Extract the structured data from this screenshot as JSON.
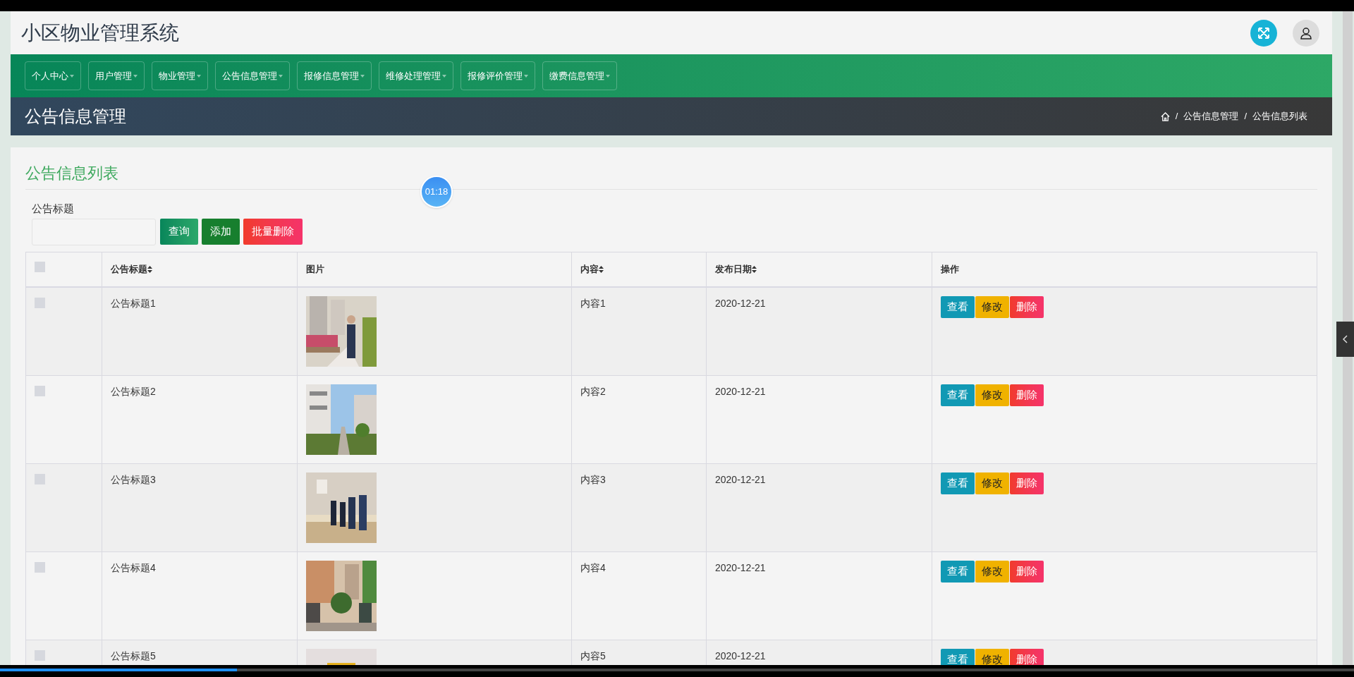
{
  "header": {
    "title": "小区物业管理系统"
  },
  "nav": [
    {
      "label": "个人中心"
    },
    {
      "label": "用户管理"
    },
    {
      "label": "物业管理"
    },
    {
      "label": "公告信息管理"
    },
    {
      "label": "报修信息管理"
    },
    {
      "label": "维修处理管理"
    },
    {
      "label": "报修评价管理"
    },
    {
      "label": "缴费信息管理"
    }
  ],
  "page_title": "公告信息管理",
  "breadcrumb": [
    {
      "separator": "/",
      "label": "公告信息管理"
    },
    {
      "separator": "/",
      "label": "公告信息列表"
    }
  ],
  "card": {
    "title": "公告信息列表",
    "search": {
      "label": "公告标题"
    },
    "buttons": [
      {
        "label": "查询",
        "kind": "query"
      },
      {
        "label": "添加",
        "kind": "add"
      },
      {
        "label": "批量删除",
        "kind": "delete"
      }
    ],
    "table": {
      "select_all_checked": false,
      "columns": [
        {
          "label": "公告标题",
          "sortable": true
        },
        {
          "label": "图片",
          "sortable": false
        },
        {
          "label": "内容",
          "sortable": true
        },
        {
          "label": "发布日期",
          "sortable": true
        },
        {
          "label": "操作",
          "sortable": false
        }
      ],
      "rows": [
        {
          "checked": false,
          "title": "公告标题1",
          "content": "内容1",
          "date": "2020-12-21",
          "actions": [
            "查看",
            "修改",
            "删除"
          ]
        },
        {
          "checked": false,
          "title": "公告标题2",
          "content": "内容2",
          "date": "2020-12-21",
          "actions": [
            "查看",
            "修改",
            "删除"
          ]
        },
        {
          "checked": false,
          "title": "公告标题3",
          "content": "内容3",
          "date": "2020-12-21",
          "actions": [
            "查看",
            "修改",
            "删除"
          ]
        },
        {
          "checked": false,
          "title": "公告标题4",
          "content": "内容4",
          "date": "2020-12-21",
          "actions": [
            "查看",
            "修改",
            "删除"
          ]
        },
        {
          "checked": false,
          "title": "公告标题5",
          "content": "内容5",
          "date": "2020-12-21",
          "actions": [
            "查看",
            "修改",
            "删除"
          ]
        }
      ]
    }
  },
  "timer": "01:18",
  "player": {
    "level": 0.175
  }
}
